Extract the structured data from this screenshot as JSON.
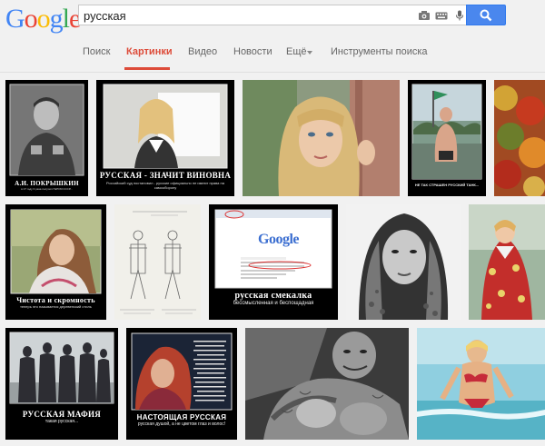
{
  "logo": {
    "letters": [
      {
        "ch": "G",
        "color": "#4285f4"
      },
      {
        "ch": "o",
        "color": "#ea4335"
      },
      {
        "ch": "o",
        "color": "#fbbc05"
      },
      {
        "ch": "g",
        "color": "#4285f4"
      },
      {
        "ch": "l",
        "color": "#34a853"
      },
      {
        "ch": "e",
        "color": "#ea4335"
      }
    ]
  },
  "search": {
    "value": "русская",
    "icons": [
      "camera-icon",
      "keyboard-icon",
      "microphone-icon",
      "search-icon"
    ]
  },
  "nav": {
    "items": [
      {
        "label": "Поиск",
        "active": false
      },
      {
        "label": "Картинки",
        "active": true
      },
      {
        "label": "Видео",
        "active": false
      },
      {
        "label": "Новости",
        "active": false
      },
      {
        "label": "Ещё",
        "active": false,
        "dropdown": true
      },
      {
        "label": "Инструменты поиска",
        "active": false
      }
    ]
  },
  "colors": {
    "accent": "#dd4b39",
    "search_button": "#4a87ee"
  },
  "results": [
    {
      "caption": "А.И. ПОКРЫШКИН",
      "subcaption": "в 17 году 3 раза получил ГЕРОЯ СССР..."
    },
    {
      "caption": "РУССКАЯ - ЗНАЧИТ ВИНОВНА",
      "subcaption": "Российский суд постановил - русские официально не имеют права на самооборону"
    },
    {
      "caption": "",
      "subcaption": ""
    },
    {
      "caption": "",
      "subcaption": "НЕ ТАК СТРАШЕН РУССКИЙ ТАНК..."
    },
    {
      "caption": "",
      "subcaption": ""
    },
    {
      "caption": "Чистота и скромность",
      "subcaption": "теперь это называется деревенский стиль"
    },
    {
      "caption": "",
      "subcaption": ""
    },
    {
      "caption": "русская смекалка",
      "subcaption": "бессмысленная и беспощадная",
      "inner_logo": "Google"
    },
    {
      "caption": "",
      "subcaption": ""
    },
    {
      "caption": "",
      "subcaption": ""
    },
    {
      "caption": "РУССКАЯ МАФИЯ",
      "subcaption": "такая русская..."
    },
    {
      "caption": "НАСТОЯЩАЯ РУССКАЯ",
      "subcaption": "русская душой, а не цветом глаз и волос!"
    },
    {
      "caption": "",
      "subcaption": ""
    },
    {
      "caption": "",
      "subcaption": ""
    }
  ]
}
